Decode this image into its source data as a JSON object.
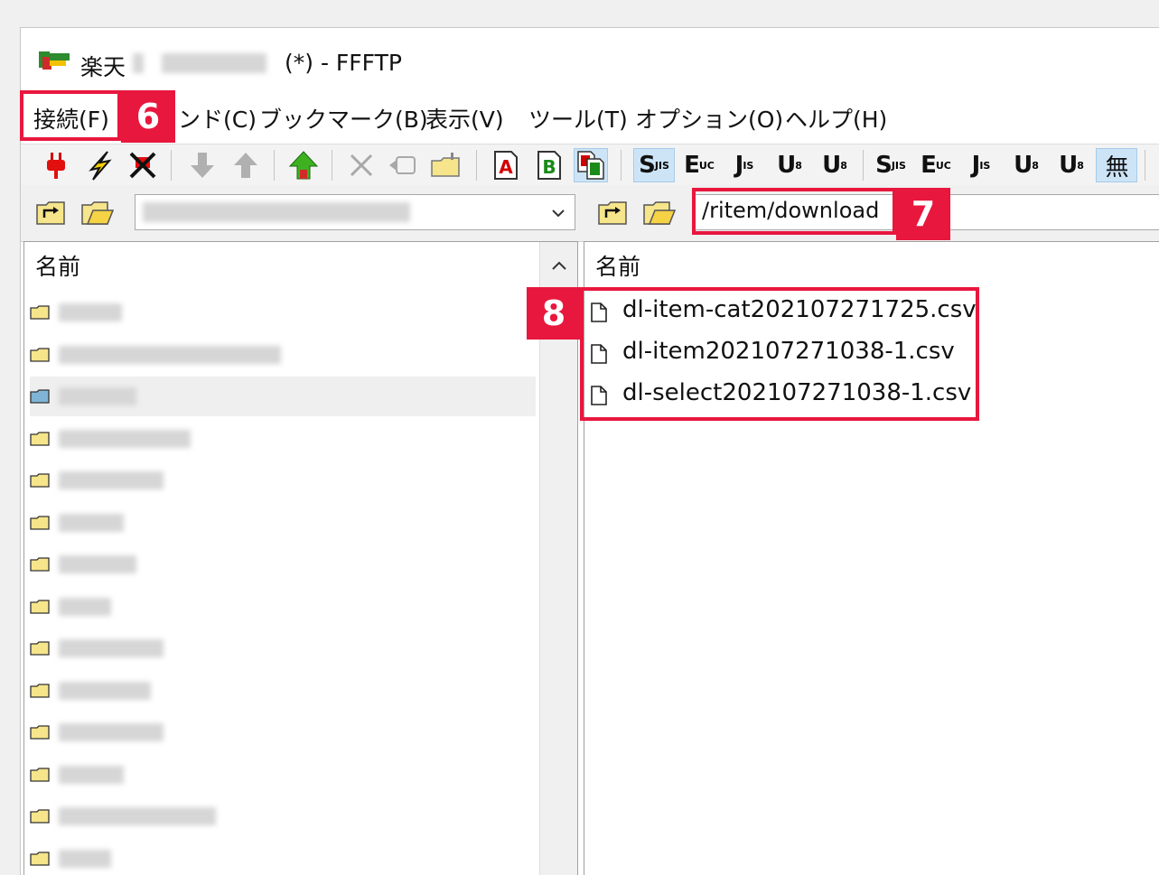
{
  "window": {
    "title_app": "楽天",
    "title_suffix": "(*) - FFFTP"
  },
  "menu": [
    "接続(F)",
    "ンド(C)",
    "ブックマーク(B)",
    "表示(V)",
    "ツール(T)",
    "オプション(O)",
    "ヘルプ(H)"
  ],
  "toolbar": {
    "connect_icon": "plug-icon",
    "quick_connect_icon": "lightning-icon",
    "disconnect_icon": "disconnect-icon",
    "download_icon": "arrow-down-icon",
    "upload_icon": "arrow-up-icon",
    "mirror_upload_icon": "house-up-icon",
    "delete_icon": "x-icon",
    "rename_icon": "rename-icon",
    "mkdir_icon": "new-folder-icon",
    "ascii_label": "A",
    "binary_label": "B",
    "codes_remote": [
      "S",
      "E",
      "J",
      "U",
      "U"
    ],
    "codes_local": [
      "S",
      "E",
      "J",
      "U",
      "U"
    ],
    "none_label": "無"
  },
  "left_pane": {
    "header": "名前"
  },
  "right_pane": {
    "path": "/ritem/download",
    "header": "名前",
    "files": [
      "dl-item-cat202107271725.csv",
      "dl-item202107271038-1.csv",
      "dl-select202107271038-1.csv"
    ]
  },
  "callouts": {
    "six": "6",
    "seven": "7",
    "eight": "8",
    "color": "#e8173e"
  }
}
